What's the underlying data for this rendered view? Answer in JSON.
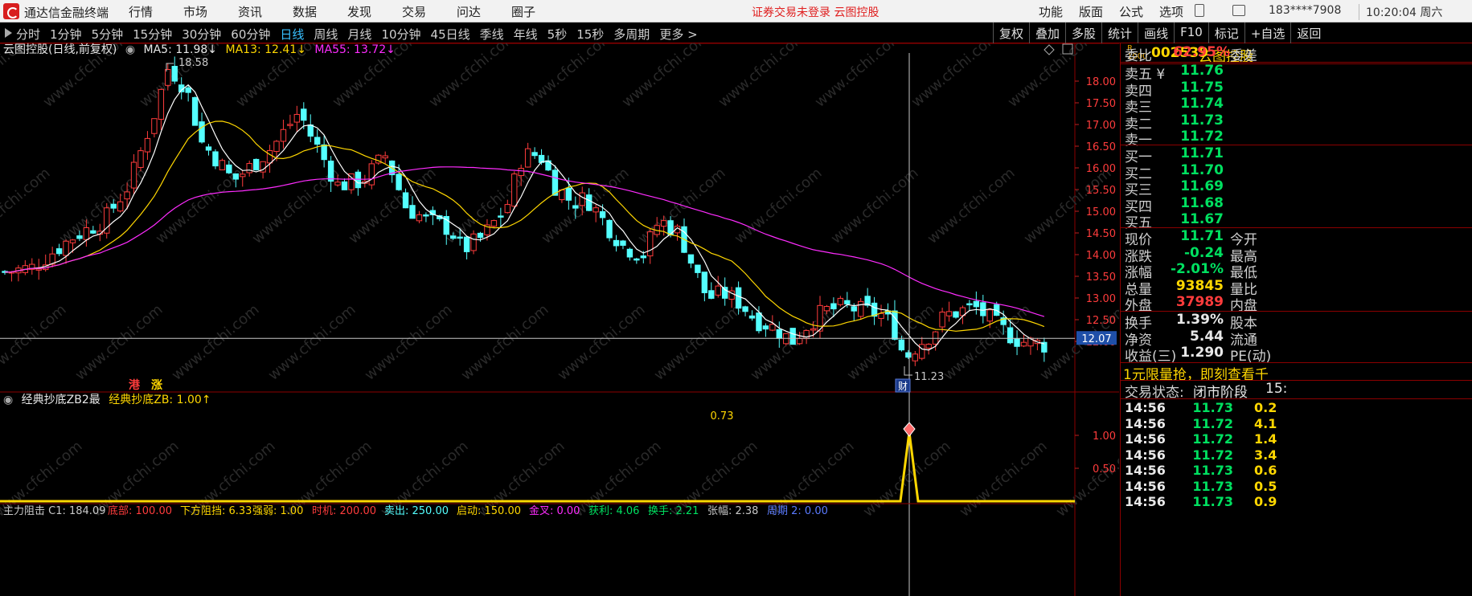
{
  "menubar": {
    "app_title": "通达信金融终端",
    "menu": [
      "行情",
      "市场",
      "资讯",
      "数据",
      "发现",
      "交易",
      "问达",
      "圈子"
    ],
    "notice": "证券交易未登录  云图控股",
    "right_menu": [
      "功能",
      "版面",
      "公式",
      "选项"
    ],
    "user": "183****7908",
    "clock": "10:20:04 周六"
  },
  "toolbar": {
    "periods": [
      "分时",
      "1分钟",
      "5分钟",
      "15分钟",
      "30分钟",
      "60分钟",
      "日线",
      "周线",
      "月线",
      "10分钟",
      "45日线",
      "季线",
      "年线",
      "5秒",
      "15秒",
      "多周期",
      "更多 >"
    ],
    "active_period": "日线",
    "actions": [
      "复权",
      "叠加",
      "多股",
      "统计",
      "画线",
      "F10",
      "标记",
      "+自选",
      "返回"
    ]
  },
  "chart": {
    "legend_title": "云图控股(日线,前复权)",
    "ma5": "MA5: 11.98↓",
    "ma13": "MA13: 12.41↓",
    "ma55": "MA55: 13.72↓",
    "high_label": "18.58",
    "low_label": "11.23",
    "last_price_tag": "12.07",
    "hk_badge": "港",
    "zhang_badge": "涨",
    "cai_badge": "财",
    "y_ticks": [
      "18.00",
      "17.50",
      "17.00",
      "16.50",
      "16.00",
      "15.50",
      "15.00",
      "14.50",
      "14.00",
      "13.50",
      "13.00",
      "12.50",
      "12.00"
    ],
    "colors": {
      "up": "#ff3c3c",
      "down": "#54ffff",
      "ma5": "#ffffff",
      "ma13": "#ffd700",
      "ma55": "#ff2cff"
    }
  },
  "indicator": {
    "title": "经典抄底ZB2最",
    "value": "经典抄底ZB: 1.00↑",
    "peak_label": "0.73",
    "y_ticks": [
      "1.00",
      "0.50"
    ]
  },
  "bottom_strip": {
    "items": [
      "主力阻击 C1: 184.09",
      "底部: 100.00",
      "下方阻挡: 6.33",
      "强弱: 1.00",
      "时机: 200.00",
      "卖出: 250.00",
      "启动: 150.00",
      "金叉: 0.00",
      "获利: 4.06",
      "换手: 2.21",
      "张幅: 2.38",
      "周期 2: 0.00"
    ]
  },
  "panel": {
    "code": "002539",
    "name": "云图控股",
    "weibi_label": "委比",
    "weibi_value": "62.95%",
    "weicha_label": "委差",
    "sells": [
      {
        "label": "卖五 ¥",
        "price": "11.76"
      },
      {
        "label": "卖四",
        "price": "11.75"
      },
      {
        "label": "卖三",
        "price": "11.74"
      },
      {
        "label": "卖二",
        "price": "11.73"
      },
      {
        "label": "卖一",
        "price": "11.72"
      }
    ],
    "buys": [
      {
        "label": "买一",
        "price": "11.71"
      },
      {
        "label": "买二",
        "price": "11.70"
      },
      {
        "label": "买三",
        "price": "11.69"
      },
      {
        "label": "买四",
        "price": "11.68"
      },
      {
        "label": "买五",
        "price": "11.67"
      }
    ],
    "quote": [
      {
        "label": "现价",
        "value": "11.71",
        "color": "green",
        "label2": "今开"
      },
      {
        "label": "涨跌",
        "value": "-0.24",
        "color": "green",
        "label2": "最高"
      },
      {
        "label": "涨幅",
        "value": "-2.01%",
        "color": "green",
        "label2": "最低"
      },
      {
        "label": "总量",
        "value": "93845",
        "color": "yellow",
        "label2": "量比"
      },
      {
        "label": "外盘",
        "value": "37989",
        "color": "red",
        "label2": "内盘"
      }
    ],
    "finance": [
      {
        "label": "换手",
        "value": "1.39%",
        "label2": "股本"
      },
      {
        "label": "净资",
        "value": "5.44",
        "label2": "流通"
      },
      {
        "label": "收益(三)",
        "value": "1.290",
        "label2": "PE(动)"
      }
    ],
    "ad_text": "1元限量抢，即刻查看千",
    "status_label": "交易状态:",
    "status_value": "闭市阶段",
    "status_time": "15:",
    "ticks": [
      {
        "time": "14:56",
        "price": "11.73",
        "vol": "0.2"
      },
      {
        "time": "14:56",
        "price": "11.72",
        "vol": "4.1"
      },
      {
        "time": "14:56",
        "price": "11.72",
        "vol": "1.4"
      },
      {
        "time": "14:56",
        "price": "11.72",
        "vol": "3.4"
      },
      {
        "time": "14:56",
        "price": "11.73",
        "vol": "0.6"
      },
      {
        "time": "14:56",
        "price": "11.73",
        "vol": "0.5"
      },
      {
        "time": "14:56",
        "price": "11.73",
        "vol": "0.9"
      }
    ]
  },
  "watermark": "www.cfchi.com"
}
